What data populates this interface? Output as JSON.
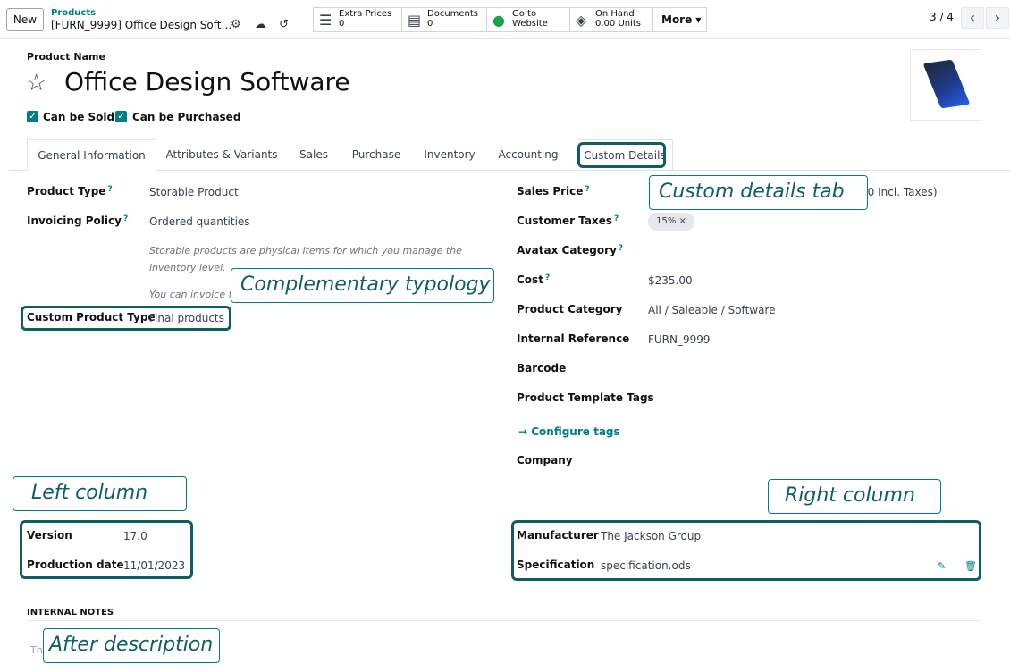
{
  "toolbar": {
    "new_label": "New",
    "breadcrumb_parent": "Products",
    "breadcrumb_current": "[FURN_9999] Office Design Soft…",
    "smart_buttons": [
      {
        "icon": "list-icon",
        "line1": "Extra Prices",
        "line2": "0"
      },
      {
        "icon": "document-icon",
        "line1": "Documents",
        "line2": "0"
      },
      {
        "icon": "globe-icon",
        "line1": "Go to",
        "line2": "Website"
      },
      {
        "icon": "cubes-icon",
        "line1": "On Hand",
        "line2": "0.00 Units"
      }
    ],
    "more_label": "More ▾",
    "pager": "3 / 4"
  },
  "header": {
    "product_name_label": "Product Name",
    "product_name": "Office Design Software",
    "can_be_sold": "Can be Sold",
    "can_be_purchased": "Can be Purchased"
  },
  "tabs": [
    "General Information",
    "Attributes & Variants",
    "Sales",
    "Purchase",
    "Inventory",
    "Accounting",
    "Custom Details"
  ],
  "left": {
    "product_type_label": "Product Type",
    "product_type": "Storable Product",
    "invoicing_label": "Invoicing Policy",
    "invoicing": "Ordered quantities",
    "help1": "Storable products are physical items for which you manage the inventory level.",
    "help2": "You can invoice t",
    "custom_type_label": "Custom Product Type",
    "custom_type": "Final products",
    "version_label": "Version",
    "version": "17.0",
    "prod_date_label": "Production date",
    "prod_date": "11/01/2023"
  },
  "right": {
    "sales_price_label": "Sales Price",
    "sales_price_tail": ")0 Incl. Taxes)",
    "customer_taxes_label": "Customer Taxes",
    "customer_tax_tag": "15% ×",
    "avatax_label": "Avatax Category",
    "cost_label": "Cost",
    "cost": "$235.00",
    "category_label": "Product Category",
    "category": "All / Saleable / Software",
    "internal_ref_label": "Internal Reference",
    "internal_ref": "FURN_9999",
    "barcode_label": "Barcode",
    "tags_label": "Product Template Tags",
    "configure_tags": "→  Configure tags",
    "company_label": "Company",
    "manufacturer_label": "Manufacturer",
    "manufacturer": "The Jackson Group",
    "specification_label": "Specification",
    "specification": "specification.ods"
  },
  "notes": {
    "label": "INTERNAL NOTES",
    "placeholder": "Thi"
  },
  "callouts": {
    "custom_details_tab": "Custom details tab",
    "complementary": "Complementary typology",
    "left_column": "Left column",
    "right_column": "Right column",
    "after_description": "After description"
  },
  "colors": {
    "accent": "#017e84",
    "highlight": "#0f5e64"
  }
}
